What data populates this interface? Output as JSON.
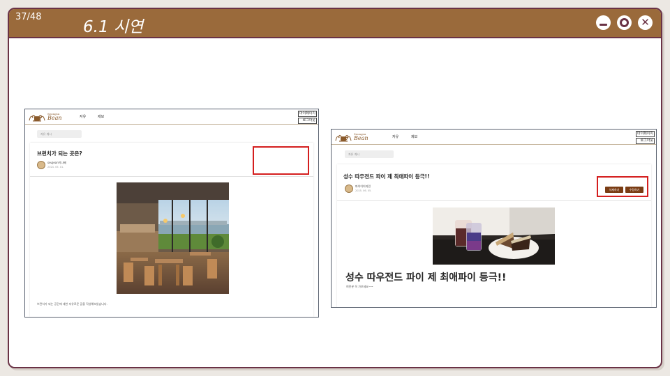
{
  "window": {
    "page_counter": "37/48",
    "title": "6.1 시연"
  },
  "left_screenshot": {
    "logo_top": "Seongsu",
    "logo_bottom": "Bean",
    "nav": [
      "자유",
      "제보"
    ],
    "right_links": [
      "마이페이지",
      "로그아웃"
    ],
    "search_placeholder": "자유 게시",
    "post_title": "브런치가 되는 곳은?",
    "author": "seujeon이나혜",
    "date": "2024. 05. 01.",
    "body": "브런치가 되는 공간에 대한 자유로운 글을 작성해보았습니다."
  },
  "right_screenshot": {
    "logo_top": "Seongsu",
    "logo_bottom": "Bean",
    "nav": [
      "자유",
      "제보"
    ],
    "right_links": [
      "마이페이지",
      "로그아웃"
    ],
    "search_placeholder": "자유 게시",
    "post_title": "성수 따우전드 파이 제 최애파이 등극!!",
    "author": "파이이이지민",
    "date": "2025. 06. 05.",
    "delete_label": "삭제하기",
    "edit_label": "수정하기",
    "big_title": "성수 따우전드 파이 제 최애파이 등극!!",
    "body": "여전분 꼭 가보세요~~"
  }
}
